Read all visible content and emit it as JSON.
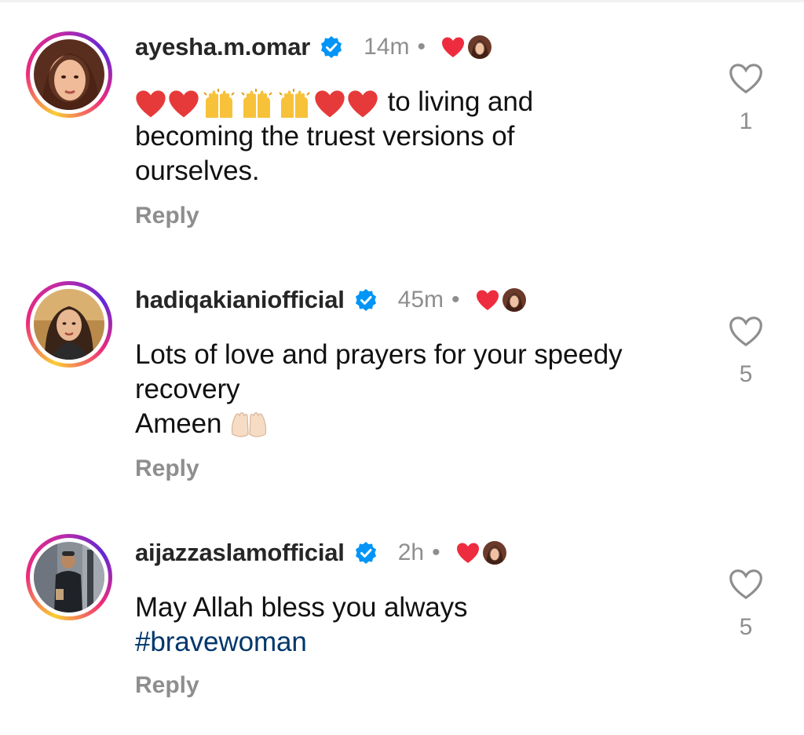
{
  "comments": [
    {
      "username": "ayesha.m.omar",
      "time": "14m",
      "separator": "•",
      "text_lines": [
        "to living and",
        "becoming the truest versions of",
        "ourselves."
      ],
      "emoji_prefix": [
        "red-heart",
        "red-heart",
        "raising-hands",
        "raising-hands",
        "raising-hands",
        "red-heart",
        "red-heart"
      ],
      "reply_label": "Reply",
      "like_count": "1",
      "verified": true,
      "liked_by_creator": true
    },
    {
      "username": "hadiqakianiofficial",
      "time": "45m",
      "separator": "•",
      "text_lines": [
        "Lots of love and prayers for your speedy",
        "recovery",
        "Ameen"
      ],
      "emoji_suffix": [
        "palms-up-together"
      ],
      "reply_label": "Reply",
      "like_count": "5",
      "verified": true,
      "liked_by_creator": true
    },
    {
      "username": "aijazzaslamofficial",
      "time": "2h",
      "separator": "•",
      "text_lines": [
        "May Allah bless you always"
      ],
      "hashtag": "#bravewoman",
      "reply_label": "Reply",
      "like_count": "5",
      "verified": true,
      "liked_by_creator": true
    }
  ],
  "colors": {
    "username": "#262626",
    "meta": "#8e8e8e",
    "verified": "#0095f6",
    "heart": "#ed2d3f",
    "hashtag": "#00376b"
  }
}
